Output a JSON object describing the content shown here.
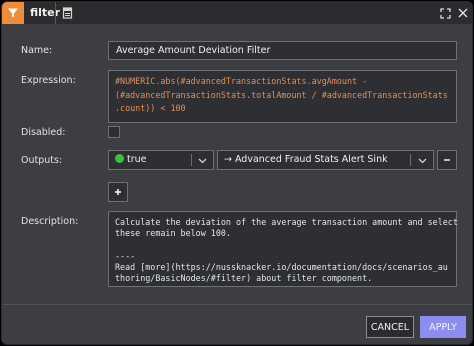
{
  "header": {
    "title": "filter"
  },
  "form": {
    "name_label": "Name:",
    "name_value": "Average Amount Deviation Filter",
    "expression_label": "Expression:",
    "expression_lines": [
      "#NUMERIC.abs(#advancedTransactionStats.avgAmount -",
      "(#advancedTransactionStats.totalAmount / #advancedTransactionStats",
      ".count)) < 100"
    ],
    "disabled_label": "Disabled:",
    "outputs_label": "Outputs:",
    "output_condition": "true",
    "output_target": "→ Advanced Fraud Stats Alert Sink",
    "description_label": "Description:",
    "description_lines": [
      "Calculate the deviation of the average transaction amount and select",
      "these remain below 100.",
      "",
      "----",
      "Read [more](https://nussknacker.io/documentation/docs/scenarios_authoring/BasicNodes/#filter) about filter component."
    ]
  },
  "footer": {
    "cancel_label": "CANCEL",
    "apply_label": "APPLY"
  },
  "colors": {
    "accent_orange": "#f08c38",
    "apply_button": "#8b8ef0",
    "true_indicator": "#3cc13b"
  },
  "icons": [
    "filter-icon",
    "document-icon",
    "expand-icon",
    "close-icon",
    "chevron-down-icon",
    "minus-icon",
    "plus-icon"
  ]
}
